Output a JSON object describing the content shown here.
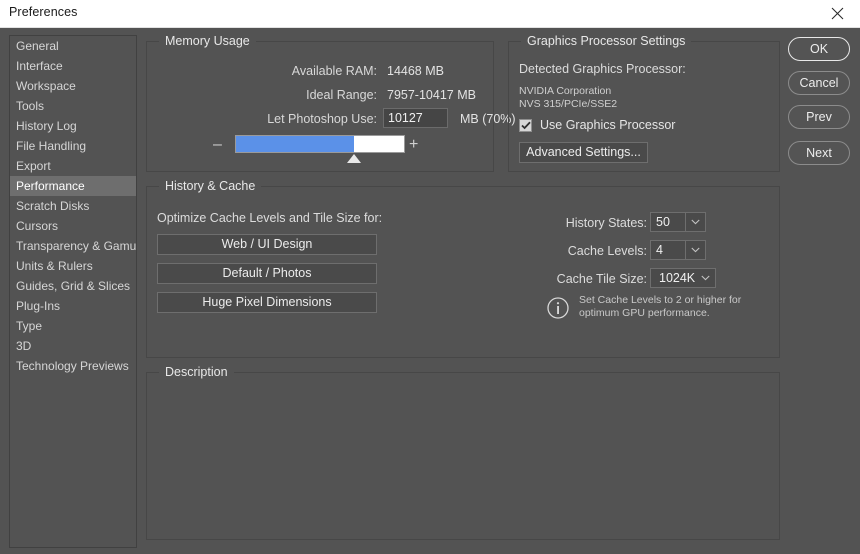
{
  "window": {
    "title": "Preferences",
    "close_icon": "close-icon"
  },
  "sidebar": {
    "items": [
      {
        "label": "General",
        "selected": false
      },
      {
        "label": "Interface",
        "selected": false
      },
      {
        "label": "Workspace",
        "selected": false
      },
      {
        "label": "Tools",
        "selected": false
      },
      {
        "label": "History Log",
        "selected": false
      },
      {
        "label": "File Handling",
        "selected": false
      },
      {
        "label": "Export",
        "selected": false
      },
      {
        "label": "Performance",
        "selected": true
      },
      {
        "label": "Scratch Disks",
        "selected": false
      },
      {
        "label": "Cursors",
        "selected": false
      },
      {
        "label": "Transparency & Gamut",
        "selected": false
      },
      {
        "label": "Units & Rulers",
        "selected": false
      },
      {
        "label": "Guides, Grid & Slices",
        "selected": false
      },
      {
        "label": "Plug-Ins",
        "selected": false
      },
      {
        "label": "Type",
        "selected": false
      },
      {
        "label": "3D",
        "selected": false
      },
      {
        "label": "Technology Previews",
        "selected": false
      }
    ]
  },
  "memory_usage": {
    "legend": "Memory Usage",
    "available_ram_label": "Available RAM:",
    "available_ram_value": "14468 MB",
    "ideal_range_label": "Ideal Range:",
    "ideal_range_value": "7957-10417 MB",
    "let_photoshop_use_label": "Let Photoshop Use:",
    "let_photoshop_use_value": "10127",
    "unit_and_percent": "MB (70%)",
    "slider_percent": 70,
    "minus_label": "–",
    "plus_label": "+",
    "fill_color": "#5b91e8"
  },
  "graphics_processor": {
    "legend": "Graphics Processor Settings",
    "detected_label": "Detected Graphics Processor:",
    "vendor": "NVIDIA Corporation",
    "model": "NVS 315/PCIe/SSE2",
    "use_gpu_label": "Use Graphics Processor",
    "use_gpu_checked": true,
    "advanced_settings_label": "Advanced Settings..."
  },
  "history_cache": {
    "legend": "History & Cache",
    "optimize_label": "Optimize Cache Levels and Tile Size for:",
    "presets": [
      {
        "label": "Web / UI Design"
      },
      {
        "label": "Default / Photos"
      },
      {
        "label": "Huge Pixel Dimensions"
      }
    ],
    "history_states_label": "History States:",
    "history_states_value": "50",
    "cache_levels_label": "Cache Levels:",
    "cache_levels_value": "4",
    "cache_tile_size_label": "Cache Tile Size:",
    "cache_tile_size_value": "1024K",
    "info_icon": "info-icon",
    "info_text": "Set Cache Levels to 2 or higher for\noptimum GPU performance."
  },
  "description": {
    "legend": "Description",
    "text": ""
  },
  "actions": {
    "ok": "OK",
    "cancel": "Cancel",
    "prev": "Prev",
    "next": "Next"
  }
}
